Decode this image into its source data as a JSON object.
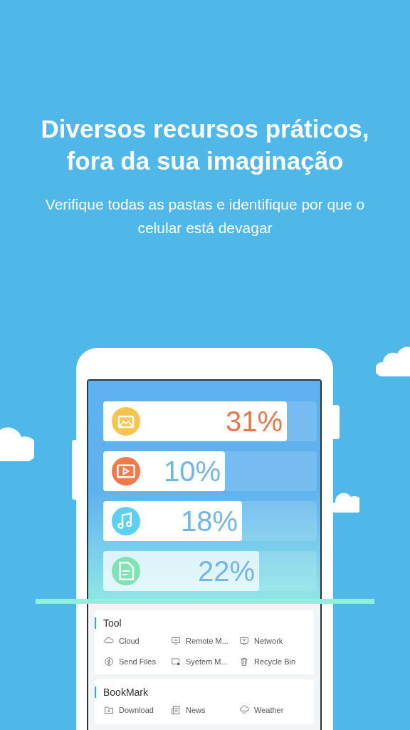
{
  "headline": [
    "Diversos recursos práticos,",
    "fora da sua imaginação"
  ],
  "subtitle": "Verifique todas as pastas e identifique por que o celular está devagar",
  "storage_bars": [
    {
      "percent": "31%",
      "level": 0.86,
      "color": "#f6c54e",
      "highlight": true
    },
    {
      "percent": "10%",
      "level": 0.57,
      "color": "#f07a48",
      "highlight": false
    },
    {
      "percent": "18%",
      "level": 0.65,
      "color": "#5ccff3",
      "highlight": false
    },
    {
      "percent": "22%",
      "level": 0.73,
      "color": "#7fe3b3",
      "highlight": false
    }
  ],
  "sections": [
    {
      "title": "Tool",
      "items": [
        "Cloud",
        "Remote M...",
        "Network",
        "Send Files",
        "Syetem M...",
        "Recycle Bin"
      ]
    },
    {
      "title": "BookMark",
      "items": [
        "Download",
        "News",
        "Weather"
      ]
    }
  ]
}
